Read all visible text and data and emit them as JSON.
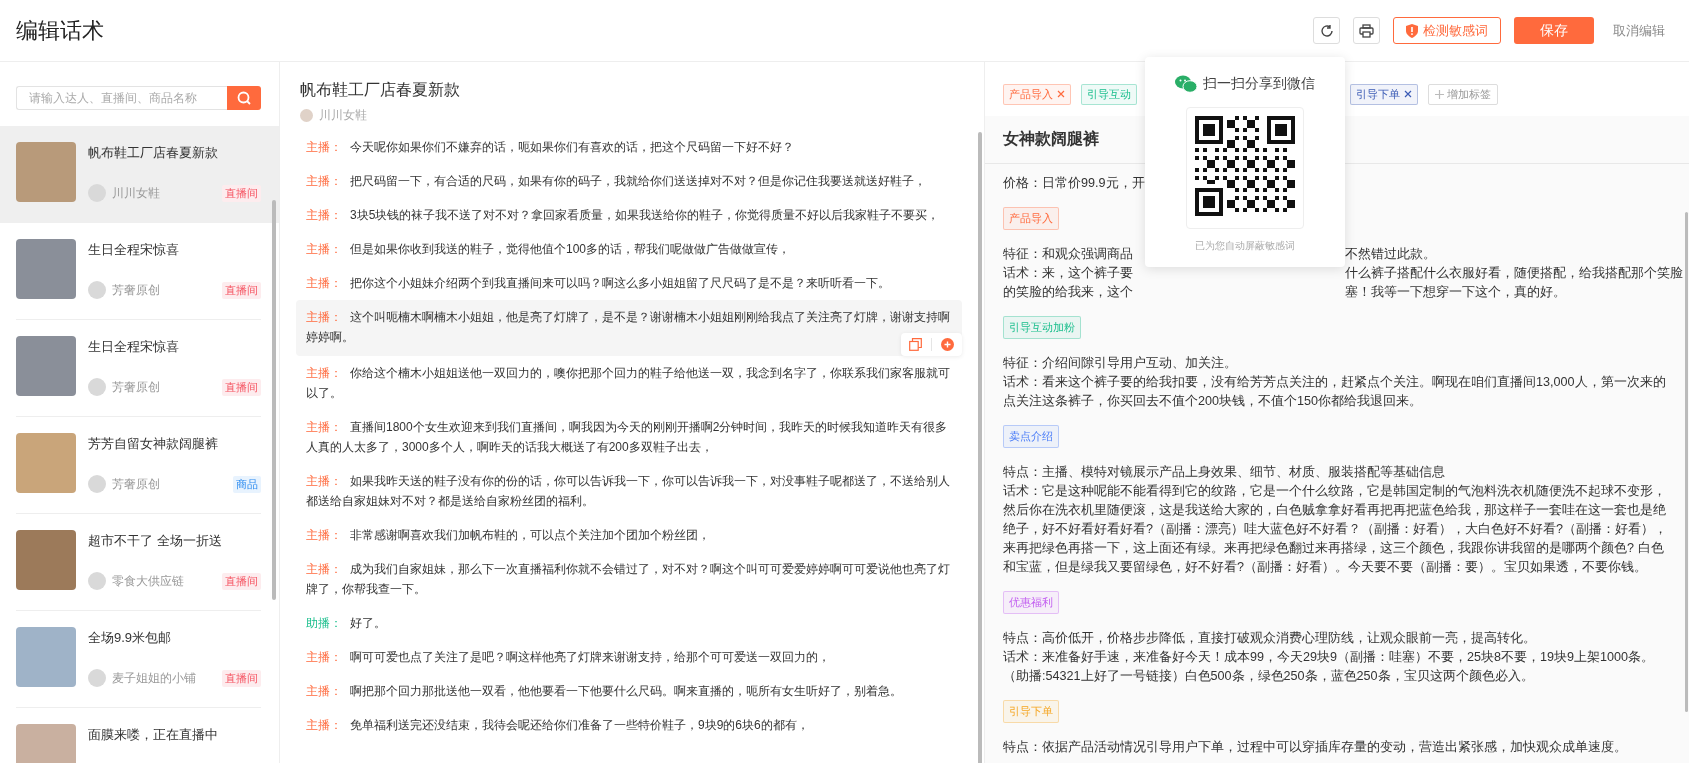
{
  "header": {
    "title": "编辑话术",
    "buttons": [
      {
        "kind": "refresh"
      },
      {
        "kind": "print"
      },
      {
        "kind": "outline",
        "label": "检测敏感词"
      },
      {
        "kind": "primary",
        "label": "保存"
      },
      {
        "kind": "text",
        "label": "取消编辑"
      }
    ]
  },
  "sidebar": {
    "search": {
      "placeholder": "请输入达人、直播间、商品名称"
    },
    "items": [
      {
        "title": "帆布鞋工厂店春夏新款",
        "author": "川川女鞋",
        "badge": {
          "text": "直播间",
          "kind": "live"
        },
        "selected": true
      },
      {
        "title": "生日全程宋惊喜",
        "author": "芳奢原创",
        "badge": {
          "text": "直播间",
          "kind": "live"
        },
        "selected": false
      },
      {
        "title": "生日全程宋惊喜",
        "author": "芳奢原创",
        "badge": {
          "text": "直播间",
          "kind": "live"
        },
        "selected": false
      },
      {
        "title": "芳芳自留女神款阔腿裤",
        "author": "芳奢原创",
        "badge": {
          "text": "商品",
          "kind": "product"
        },
        "selected": false
      },
      {
        "title": "超市不干了 全场一折送",
        "author": "零食大供应链",
        "badge": {
          "text": "直播间",
          "kind": "live"
        },
        "selected": false
      },
      {
        "title": "全场9.9米包邮",
        "author": "麦子姐姐的小铺",
        "badge": {
          "text": "直播间",
          "kind": "live"
        },
        "selected": false
      },
      {
        "title": "面膜来喽，正在直播中",
        "selected": false
      }
    ]
  },
  "script": {
    "title": "帆布鞋工厂店春夏新款",
    "author": "川川女鞋",
    "lines": [
      {
        "speaker": "主播：",
        "kind": "host",
        "text": "今天呢你如果你们不嫌弃的话，呃如果你们有喜欢的话，把这个尺码留一下好不好？",
        "highlighted": false
      },
      {
        "speaker": "主播：",
        "kind": "host",
        "text": "把尺码留一下，有合适的尺码，如果有你的码子，我就给你们送送掉对不对？但是你记住我要送就送好鞋子，",
        "highlighted": false
      },
      {
        "speaker": "主播：",
        "kind": "host",
        "text": "3块5块钱的袜子我不送了对不对？拿回家看质量，如果我送给你的鞋子，你觉得质量不好以后我家鞋子不要买，",
        "highlighted": false
      },
      {
        "speaker": "主播：",
        "kind": "host",
        "text": "但是如果你收到我送的鞋子，觉得他值个100多的话，帮我们呢做做广告做做宣传，",
        "highlighted": false
      },
      {
        "speaker": "主播：",
        "kind": "host",
        "text": "把你这个小姐妹介绍两个到我直播间来可以吗？啊这么多小姐姐留了尺尺码了是不是？来听听看一下。",
        "highlighted": false
      },
      {
        "speaker": "主播：",
        "kind": "host",
        "text": "这个叫呃楠木啊楠木小姐姐，他是亮了灯牌了，是不是？谢谢楠木小姐姐刚刚给我点了关注亮了灯牌，谢谢支持啊婷婷啊。",
        "highlighted": true
      },
      {
        "speaker": "主播：",
        "kind": "host",
        "text": "你给这个楠木小姐姐送他一双回力的，噢你把那个回力的鞋子给他送一双，我念到名字了，你联系我们家客服就可以了。",
        "highlighted": false
      },
      {
        "speaker": "主播：",
        "kind": "host",
        "text": "直播间1800个女生欢迎来到我们直播间，啊我因为今天的刚刚开播啊2分钟时间，我昨天的时候我知道昨天有很多人真的人太多了，3000多个人，啊昨天的话我大概送了有200多双鞋子出去，",
        "highlighted": false
      },
      {
        "speaker": "主播：",
        "kind": "host",
        "text": "如果我昨天送的鞋子没有你的份的话，你可以告诉我一下，你可以告诉我一下，对没事鞋子呢都送了，不送给别人都送给自家姐妹对不对？都是送给自家粉丝团的福利。",
        "highlighted": false
      },
      {
        "speaker": "主播：",
        "kind": "host",
        "text": "非常感谢啊喜欢我们加帆布鞋的，可以点个关注加个团加个粉丝团，",
        "highlighted": false
      },
      {
        "speaker": "主播：",
        "kind": "host",
        "text": "成为我们自家姐妹，那么下一次直播福利你就不会错过了，对不对？啊这个叫可可爱爱婷婷啊可可爱说他也亮了灯牌了，你帮我查一下。",
        "highlighted": false
      },
      {
        "speaker": "助播：",
        "kind": "assistant",
        "text": "好了。",
        "highlighted": false
      },
      {
        "speaker": "主播：",
        "kind": "host",
        "text": "啊可可爱也点了关注了是吧？啊这样他亮了灯牌来谢谢支持，给那个可可爱送一双回力的，",
        "highlighted": false
      },
      {
        "speaker": "主播：",
        "kind": "host",
        "text": "啊把那个回力那批送他一双看，他他要看一下他要什么尺码。啊来直播的，呃所有女生听好了，别着急。",
        "highlighted": false
      },
      {
        "speaker": "主播：",
        "kind": "host",
        "text": "免单福利送完还没结束，我待会呢还给你们准备了一些特价鞋子，9块9的6块6的都有，",
        "highlighted": false
      }
    ]
  },
  "detail": {
    "tag_bar": {
      "before_popup": [
        {
          "label": "产品导入",
          "kind": "warm"
        },
        {
          "label": "引导互动",
          "kind": "mint"
        }
      ],
      "after_popup": [
        {
          "label": "引导下单",
          "kind": "navy"
        }
      ],
      "add_label": "增加标签"
    },
    "title": "女神款阔腿裤",
    "price": "价格：日常价99.9元，开",
    "sections": [
      {
        "tag": "产品导入",
        "kind": "warm",
        "lines": [
          {
            "left": "特征：和观众强调商品",
            "right": "不然错过此款。"
          },
          {
            "left": "话术：来，这个裤子要",
            "right": "什么裤子搭配什么衣服好看，随便搭配，给我搭配那个笑脸"
          },
          {
            "left": "的笑脸的给我来，这个",
            "right": "塞！我等一下想穿一下这个，真的好。"
          }
        ]
      },
      {
        "tag": "引导互动加粉",
        "kind": "mint",
        "paragraphs": [
          "特征：介绍间隙引导用户互动、加关注。",
          "话术：看来这个裤子要的给我扣要，没有给芳芳点关注的，赶紧点个关注。啊现在咱们直播间13,000人，第一次来的点关注这条裤子，你买回去不值个200块钱，不值个150你都给我退回来。"
        ]
      },
      {
        "tag": "卖点介绍",
        "kind": "sky",
        "paragraphs": [
          "特点：主播、模特对镜展示产品上身效果、细节、材质、服装搭配等基础信息",
          "话术：它是这种呢能不能看得到它的纹路，它是一个什么纹路，它是韩国定制的气泡料洗衣机随便洗不起球不变形，然后你在洗衣机里随便滚，这是我送给大家的，白色贼拿拿好看再把再把蓝色给我，那这样子一套哇在这一套也是绝绝子，好不好看好看好看?（副播：漂亮）哇大蓝色好不好看？（副播：好看），大白色好不好看?（副播：好看），来再把绿色再搭一下，这上面还有绿。来再把绿色翻过来再搭绿，这三个颜色，我跟你讲我留的是哪两个颜色? 白色和宝蓝，但是绿我又要留绿色，好不好看?（副播：好看）。今天要不要（副播：要）。宝贝如果透，不要你钱。"
        ]
      },
      {
        "tag": "优惠福利",
        "kind": "violet",
        "paragraphs": [
          "特点：高价低开，价格步步降低，直接打破观众消费心理防线，让观众眼前一亮，提高转化。",
          "话术：来准备好手速，来准备好今天！成本99，今天29块9（副播：哇塞）不要，25块8不要，19块9上架1000条。（助播:54321上好了一号链接）白色500条，绿色250条，蓝色250条，宝贝这两个颜色必入。"
        ]
      },
      {
        "tag": "引导下单",
        "kind": "amber",
        "paragraphs": [
          "特点：依据产品活动情况引导用户下单，过程中可以穿插库存量的变动，营造出紧张感，加快观众成单速度。"
        ]
      }
    ]
  },
  "share_popup": {
    "title": "扫一扫分享到微信",
    "note": "已为您自动屏蔽敏感词"
  }
}
